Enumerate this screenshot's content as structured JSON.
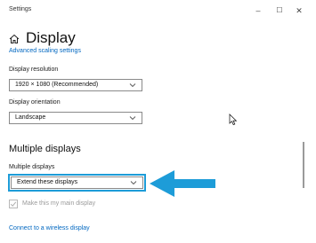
{
  "window": {
    "title": "Settings",
    "minimize": "–",
    "maximize": "☐",
    "close": "✕"
  },
  "header": {
    "icon": "home-icon",
    "title": "Display"
  },
  "links": {
    "advanced_scaling": "Advanced scaling settings",
    "connect_wireless": "Connect to a wireless display"
  },
  "resolution": {
    "label": "Display resolution",
    "value": "1920 × 1080 (Recommended)"
  },
  "orientation": {
    "label": "Display orientation",
    "value": "Landscape"
  },
  "multiple_displays": {
    "section_title": "Multiple displays",
    "label": "Multiple displays",
    "value": "Extend these displays",
    "main_display_checkbox": "Make this my main display"
  },
  "annotation": {
    "arrow_color": "#1d9cd8",
    "highlight_color": "#1d9cd8"
  }
}
